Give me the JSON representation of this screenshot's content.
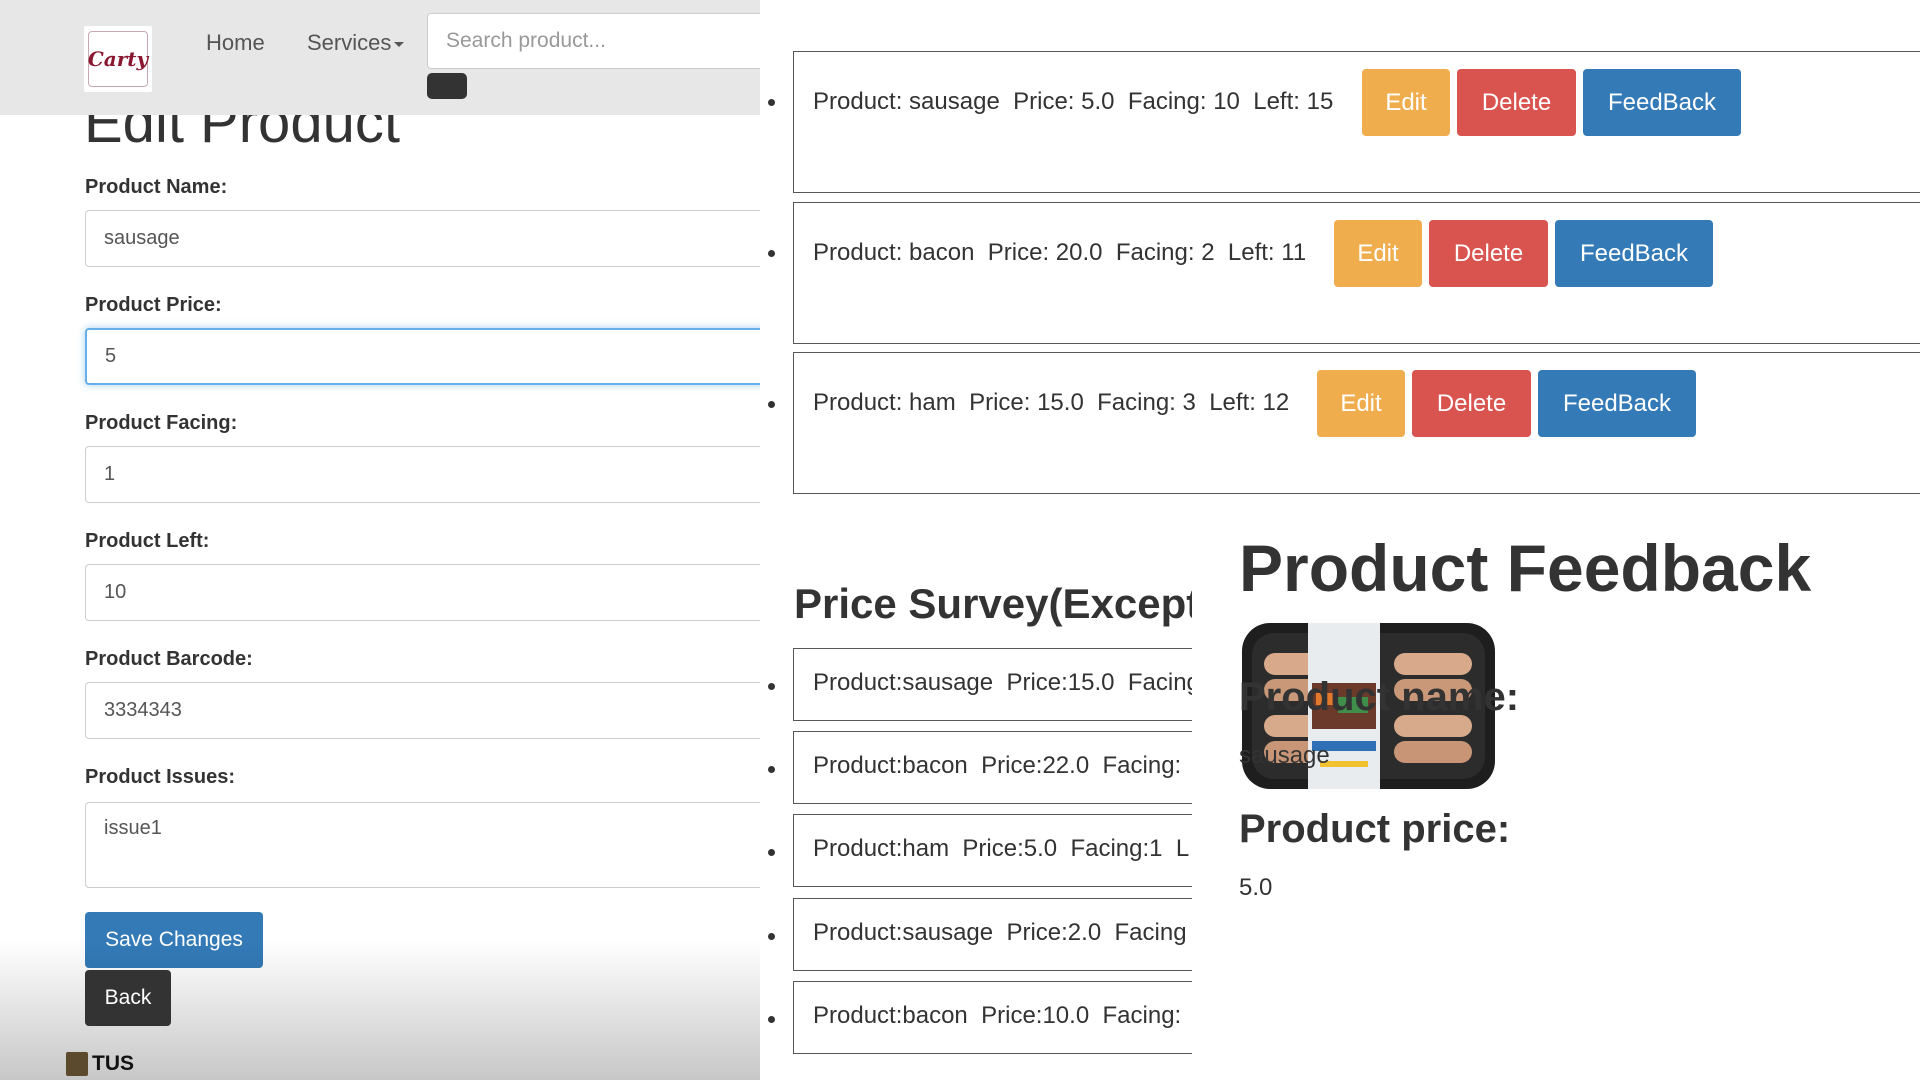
{
  "navbar": {
    "logo_text": "Carty",
    "home_label": "Home",
    "services_label": "Services",
    "search_placeholder": "Search product..."
  },
  "edit_form": {
    "title": "Edit Product",
    "fields": [
      {
        "label": "Product Name:",
        "value": "sausage"
      },
      {
        "label": "Product Price:",
        "value": "5"
      },
      {
        "label": "Product Facing:",
        "value": "1"
      },
      {
        "label": "Product Left:",
        "value": "10"
      },
      {
        "label": "Product Barcode:",
        "value": "3334343"
      },
      {
        "label": "Product Issues:",
        "value": "issue1"
      }
    ],
    "save_label": "Save Changes",
    "back_label": "Back"
  },
  "footer": {
    "brand": "TUS"
  },
  "products": [
    {
      "text": "Product: sausage  Price: 5.0  Facing: 10  Left: 15"
    },
    {
      "text": "Product: bacon  Price: 20.0  Facing: 2  Left: 11"
    },
    {
      "text": "Product: ham  Price: 15.0  Facing: 3  Left: 12"
    }
  ],
  "product_buttons": {
    "edit": "Edit",
    "delete": "Delete",
    "feedback": "FeedBack"
  },
  "survey": {
    "title": "Price Survey(Except",
    "items": [
      "Product:sausage  Price:15.0  Facing",
      "Product:bacon  Price:22.0  Facing:",
      "Product:ham  Price:5.0  Facing:1  L",
      "Product:sausage  Price:2.0  Facing",
      "Product:bacon  Price:10.0  Facing:"
    ]
  },
  "feedback": {
    "title": "Product Feedback",
    "image_icon": "sausage-pack-image",
    "name_heading": "Product name:",
    "name_value": "sausage",
    "price_heading": "Product price:",
    "price_value": "5.0"
  },
  "colors": {
    "primary": "#337ab7",
    "warning": "#f0ad4e",
    "danger": "#d9534f",
    "dark": "#333333",
    "navbar_bg": "#e7e7e7"
  }
}
